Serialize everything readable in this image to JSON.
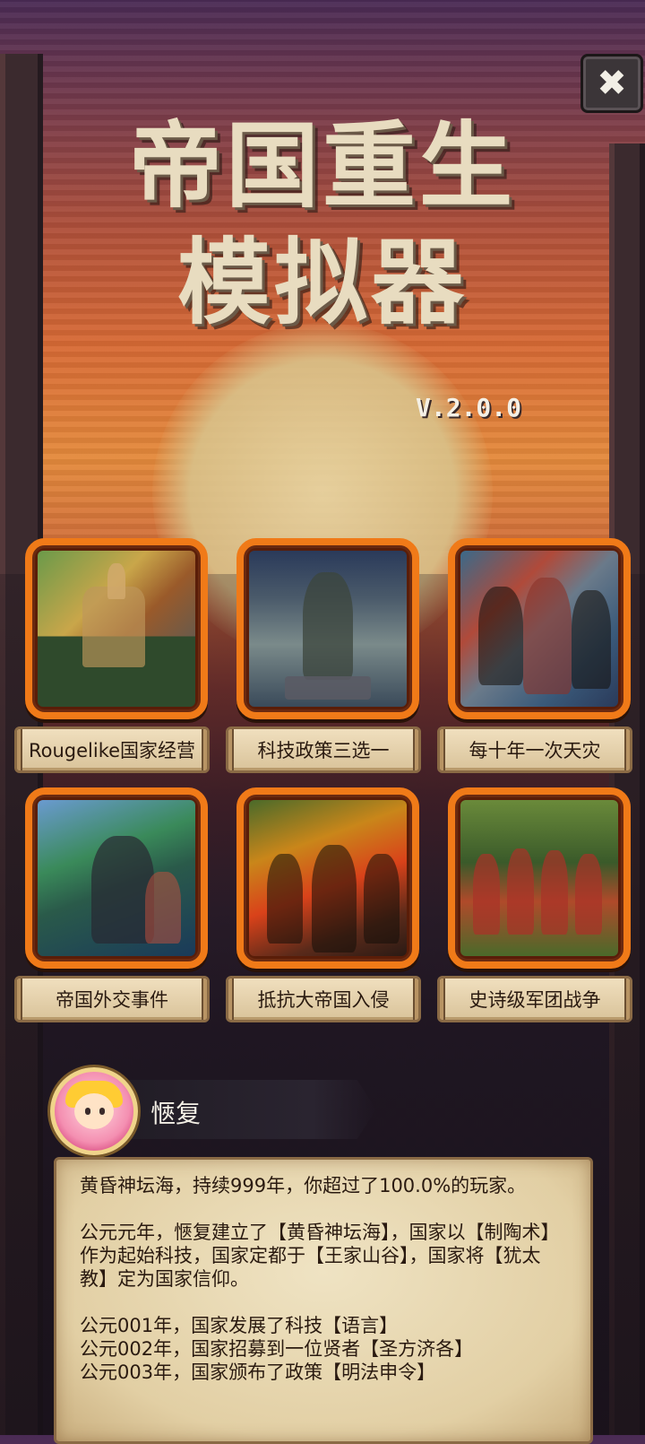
{
  "title": {
    "line1": "帝国重生",
    "line2": "模拟器",
    "version": "V.2.0.0"
  },
  "close_button": {
    "label": "✖",
    "icon": "close-icon"
  },
  "features": [
    {
      "label": "Rougelike国家经营",
      "icon": "town-art"
    },
    {
      "label": "科技政策三选一",
      "icon": "statue-art"
    },
    {
      "label": "每十年一次天灾",
      "icon": "knights-art"
    },
    {
      "label": "帝国外交事件",
      "icon": "warrior-art"
    },
    {
      "label": "抵抗大帝国入侵",
      "icon": "fire-battle-art"
    },
    {
      "label": "史诗级军团战争",
      "icon": "army-art"
    }
  ],
  "player": {
    "name": "愜复",
    "avatar": "avatar-icon"
  },
  "log": {
    "summary": "黄昏神坛海，持续999年，你超过了100.0%的玩家。",
    "founding": "公元元年，愜复建立了【黄昏神坛海】，国家以【制陶术】作为起始科技，国家定都于【王家山谷】，国家将【犹太教】定为国家信仰。",
    "events": [
      "公元001年，国家发展了科技【语言】",
      "公元002年，国家招募到一位贤者【圣方济各】",
      "公元003年，国家颁布了政策【明法申令】"
    ]
  },
  "colors": {
    "frame_orange": "#f07a18",
    "parchment": "#e8d6ae",
    "title": "#e8dcc0"
  }
}
